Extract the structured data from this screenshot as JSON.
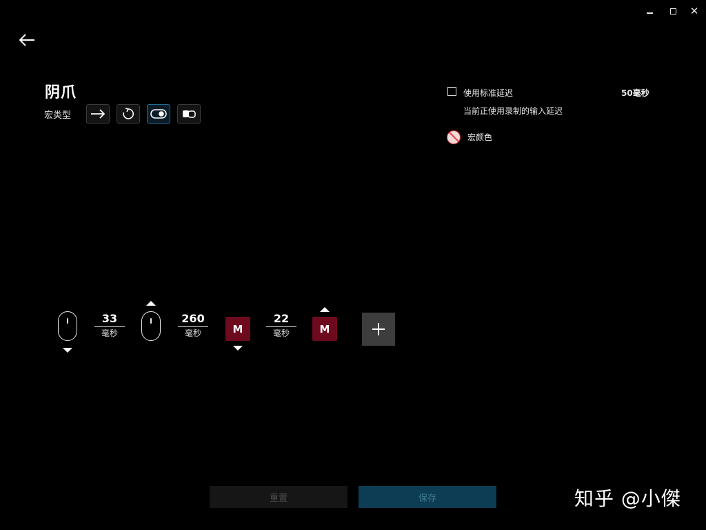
{
  "window_controls": {
    "minimize_icon": "minimize-icon",
    "maximize_icon": "maximize-icon",
    "close_icon": "close-icon",
    "close_glyph": "✕"
  },
  "header": {
    "back_icon": "back-arrow-icon",
    "title": "阴爪",
    "macro_type_label": "宏类型",
    "macro_types": [
      {
        "icon": "arrow-right-icon",
        "active": false
      },
      {
        "icon": "repeat-icon",
        "active": false
      },
      {
        "icon": "toggle-icon",
        "active": true
      },
      {
        "icon": "sequence-icon",
        "active": false
      }
    ]
  },
  "settings": {
    "standard_delay_label": "使用标准延迟",
    "standard_delay_checked": false,
    "standard_delay_value": "50毫秒",
    "delay_note": "当前正使用录制的输入延迟",
    "macro_color_label": "宏颜色",
    "macro_color_icon": "no-color-icon"
  },
  "timeline": {
    "steps": [
      {
        "kind": "mouse",
        "direction": "down"
      },
      {
        "kind": "delay",
        "value": "33",
        "unit": "毫秒"
      },
      {
        "kind": "mouse",
        "direction": "up"
      },
      {
        "kind": "delay",
        "value": "260",
        "unit": "毫秒"
      },
      {
        "kind": "key",
        "label": "M",
        "direction": "down"
      },
      {
        "kind": "delay",
        "value": "22",
        "unit": "毫秒"
      },
      {
        "kind": "key",
        "label": "M",
        "direction": "up"
      }
    ],
    "add_icon": "plus-icon"
  },
  "footer": {
    "reset_label": "重置",
    "save_label": "保存"
  },
  "watermark": "知乎 @小傑",
  "colors": {
    "background": "#000000",
    "key_block": "#6e0a1e",
    "save_button": "#0c3d54",
    "active_type_border": "#1f6f9a",
    "swatch_red": "#e03a3a"
  }
}
